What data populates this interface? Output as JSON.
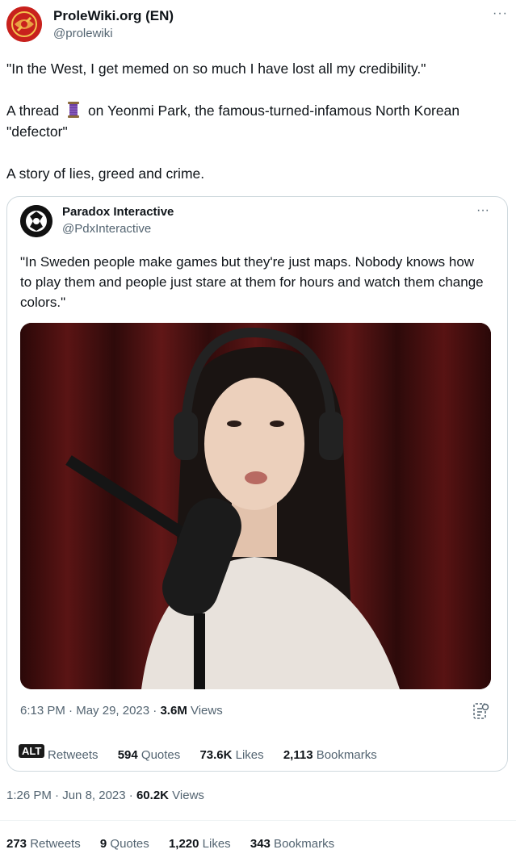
{
  "author": {
    "name": "ProleWiki.org (EN)",
    "handle": "@prolewiki",
    "more": "···"
  },
  "tweet": {
    "line1": "\"In the West, I get memed on so much I have lost all my credibility.\"",
    "line2_pre": "A thread",
    "line2_post": "on Yeonmi Park, the famous-turned-infamous North Korean",
    "line2_cont": "\"defector\"",
    "line3": "A story of lies, greed and crime.",
    "emoji_icon": "thread-spool-icon"
  },
  "quote": {
    "name": "Paradox Interactive",
    "handle": "@PdxInteractive",
    "more": "···",
    "text": "\"In Sweden people make games but they're just maps. Nobody knows how to play them and people just stare at them for hours and watch them change colors.\"",
    "time": "6:13 PM",
    "sep1": " · ",
    "date": "May 29, 2023",
    "sep2": " · ",
    "views_count": "3.6M",
    "views_label": " Views",
    "alt": "ALT",
    "stats": {
      "retweets_label": "Retweets",
      "quotes_count": "594",
      "quotes_label": " Quotes",
      "likes_count": "73.6K",
      "likes_label": " Likes",
      "bookmarks_count": "2,113",
      "bookmarks_label": " Bookmarks"
    }
  },
  "main_meta": {
    "time": "1:26 PM",
    "sep1": " · ",
    "date": "Jun 8, 2023",
    "sep2": " · ",
    "views_count": "60.2K",
    "views_label": " Views"
  },
  "main_stats": {
    "retweets_count": "273",
    "retweets_label": " Retweets",
    "quotes_count": "9",
    "quotes_label": " Quotes",
    "likes_count": "1,220",
    "likes_label": " Likes",
    "bookmarks_count": "343",
    "bookmarks_label": " Bookmarks"
  },
  "colors": {
    "text": "#0f1419",
    "secondary": "#536471",
    "border": "#cfd9de",
    "prolewiki_red": "#c8211d"
  }
}
